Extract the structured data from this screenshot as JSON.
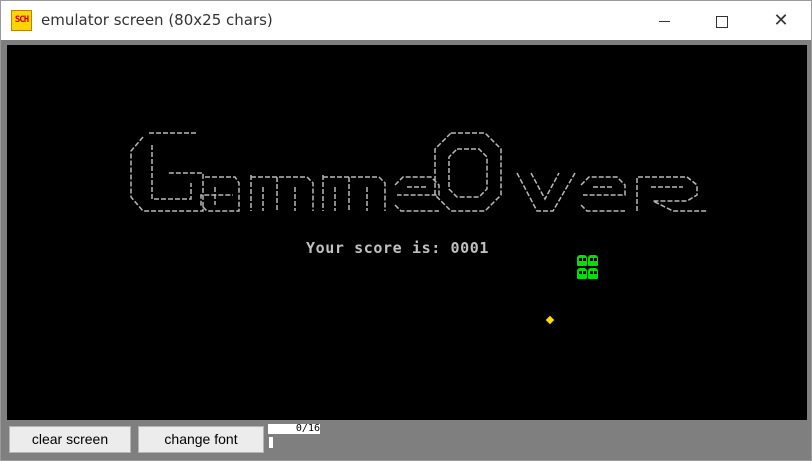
{
  "window": {
    "title": "emulator screen (80x25 chars)",
    "icon_text": "SCH",
    "controls": [
      "minimize",
      "maximize",
      "close"
    ]
  },
  "game": {
    "banner_text": "Game Over",
    "score_label": "Your score is: 0001",
    "ghost_color": "#00e000",
    "food_color": "#ffe000",
    "text_color": "#c0c0c0"
  },
  "toolbar": {
    "clear_label": "clear screen",
    "font_label": "change font",
    "counter": "0/16"
  }
}
